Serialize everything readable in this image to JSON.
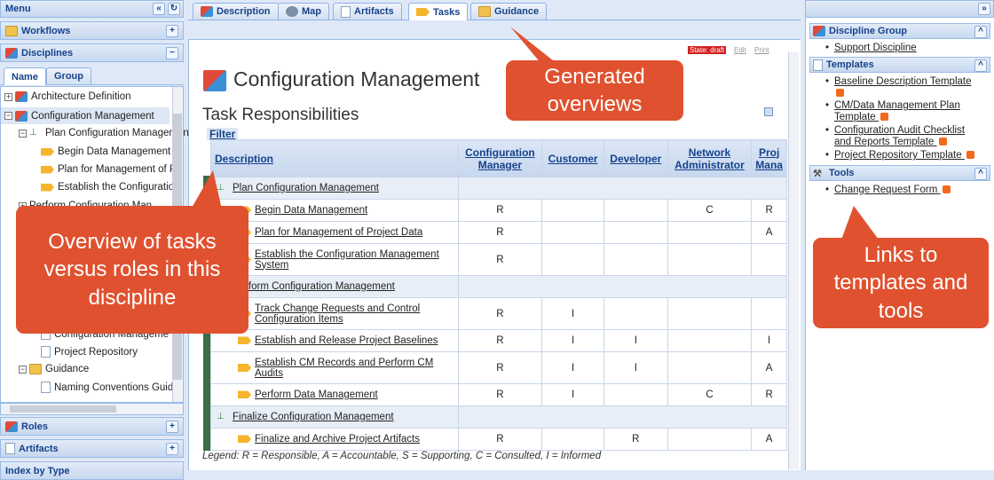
{
  "menu": {
    "title": "Menu",
    "sections": {
      "workflows": "Workflows",
      "disciplines": "Disciplines",
      "roles": "Roles",
      "artifacts": "Artifacts",
      "index": "Index by Type"
    },
    "tabs": {
      "name": "Name",
      "group": "Group"
    },
    "tree": [
      "Architecture Definition",
      "Configuration Management",
      "Plan Configuration Management",
      "Begin Data Management",
      "Plan for Management of P",
      "Establish the Configuratio",
      "Perform Configuration Man",
      "Configuration Manageme",
      "Project Repository",
      "Guidance",
      "Naming Conventions Guid"
    ]
  },
  "tabs": [
    "Description",
    "Map",
    "Artifacts",
    "Tasks",
    "Guidance"
  ],
  "content": {
    "state": "State: draft",
    "edit": "Edit",
    "print": "Print",
    "title": "Configuration Management",
    "subtitle": "Task Responsibilities",
    "filter": "Filter",
    "columns": [
      "Description",
      "Configuration Manager",
      "Customer",
      "Developer",
      "Network Administrator",
      "Proj Mana"
    ],
    "rows": [
      {
        "type": "group",
        "name": "Plan Configuration Management"
      },
      {
        "type": "task",
        "name": "Begin Data Management",
        "v": [
          "R",
          "",
          "",
          "C",
          "R"
        ]
      },
      {
        "type": "task",
        "name": "Plan for Management of Project Data",
        "v": [
          "R",
          "",
          "",
          "",
          "A"
        ]
      },
      {
        "type": "task",
        "name": "Establish the Configuration Management System",
        "v": [
          "R",
          "",
          "",
          "",
          ""
        ]
      },
      {
        "type": "group",
        "name": "Perform Configuration Management"
      },
      {
        "type": "task",
        "name": "Track Change Requests and Control Configuration Items",
        "v": [
          "R",
          "I",
          "",
          "",
          ""
        ]
      },
      {
        "type": "task",
        "name": "Establish and Release Project Baselines",
        "v": [
          "R",
          "I",
          "I",
          "",
          "I"
        ]
      },
      {
        "type": "task",
        "name": "Establish CM Records and Perform CM Audits",
        "v": [
          "R",
          "I",
          "I",
          "",
          "A"
        ]
      },
      {
        "type": "task",
        "name": "Perform Data Management",
        "v": [
          "R",
          "I",
          "",
          "C",
          "R"
        ]
      },
      {
        "type": "group",
        "name": "Finalize Configuration Management"
      },
      {
        "type": "task",
        "name": "Finalize and Archive Project Artifacts",
        "v": [
          "R",
          "",
          "R",
          "",
          "A"
        ]
      }
    ],
    "legend": "Legend: R = Responsible, A = Accountable, S = Supporting, C = Consulted, I = Informed"
  },
  "right": {
    "discipline_group": {
      "title": "Discipline Group",
      "items": [
        "Support Discipline"
      ]
    },
    "templates": {
      "title": "Templates",
      "items": [
        "Baseline Description Template",
        "CM/Data Management Plan Template",
        "Configuration Audit Checklist and Reports Template",
        "Project Repository Template"
      ]
    },
    "tools": {
      "title": "Tools",
      "items": [
        "Change Request Form"
      ]
    }
  },
  "callouts": {
    "generated": "Generated overviews",
    "overview": "Overview of tasks versus roles in this discipline",
    "links": "Links to templates and tools"
  }
}
